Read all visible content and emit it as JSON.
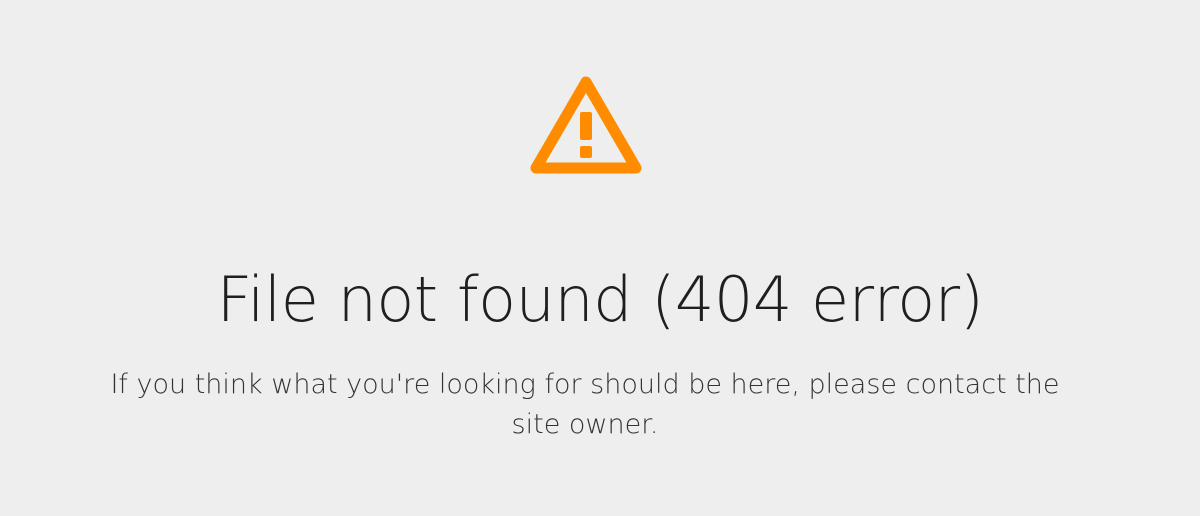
{
  "error_page": {
    "icon": "warning-icon",
    "icon_color": "#ff8c00",
    "title": "File not found (404 error)",
    "message": "If you think what you're looking for should be here, please contact the site owner."
  },
  "colors": {
    "background": "#eeeeee",
    "text": "#1f1f1f"
  }
}
